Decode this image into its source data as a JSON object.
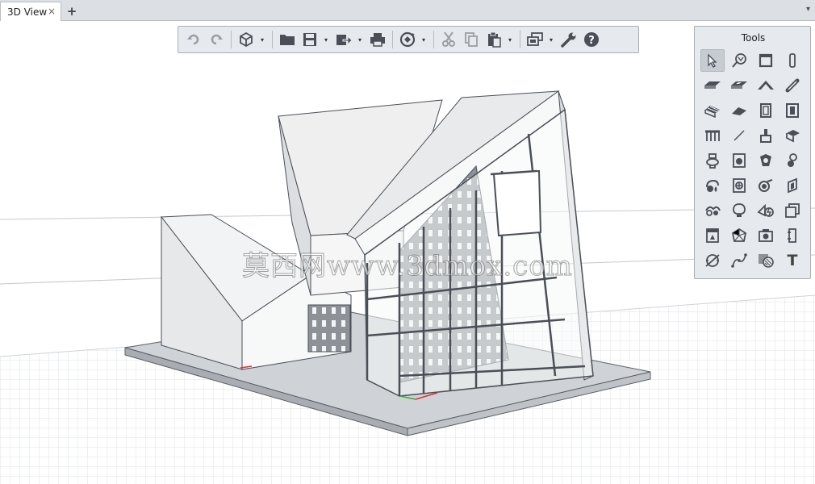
{
  "tab": {
    "label": "3D View",
    "close": "×",
    "add": "+",
    "menu": "▾"
  },
  "toolbar": {
    "buttons": [
      "undo-icon",
      "redo-icon",
      "3d-view-icon",
      "open-folder-icon",
      "save-icon",
      "export-icon",
      "print-icon",
      "orbit-icon",
      "cut-icon",
      "copy-icon",
      "paste-icon",
      "layers-icon",
      "settings-wrench-icon",
      "help-icon"
    ],
    "dropdown_glyph": "▾"
  },
  "tools_panel": {
    "title": "Tools",
    "text_tool_label": "T",
    "icons": [
      "select-pointer-icon",
      "annotation-icon",
      "window-icon",
      "column-icon",
      "slab-icon",
      "hollow-slab-icon",
      "roof-icon",
      "beam-icon",
      "stair-icon",
      "ramp-icon",
      "door-icon",
      "curtain-panel-icon",
      "railing-icon",
      "line-icon",
      "plumbing-icon",
      "corner-icon",
      "toilet-icon",
      "washer-icon",
      "fixture-icon",
      "valve-icon",
      "fire-icon",
      "fan-coil-icon",
      "pipe-fitting-icon",
      "duct-icon",
      "pipe-icon",
      "light-fixture-icon",
      "electrical-icon",
      "equipment-icon",
      "panel-icon",
      "polyhedron-icon",
      "camera-icon",
      "cabinet-icon",
      "dimension-icon",
      "spline-icon",
      "hatch-icon",
      "text-tool-icon"
    ]
  },
  "watermark": {
    "text": "莫西网www.3dmox.com"
  },
  "colors": {
    "accent": "#4a4f57",
    "toolbar_bg": "#e6e9ed",
    "tab_bg": "#dcdfe4"
  }
}
